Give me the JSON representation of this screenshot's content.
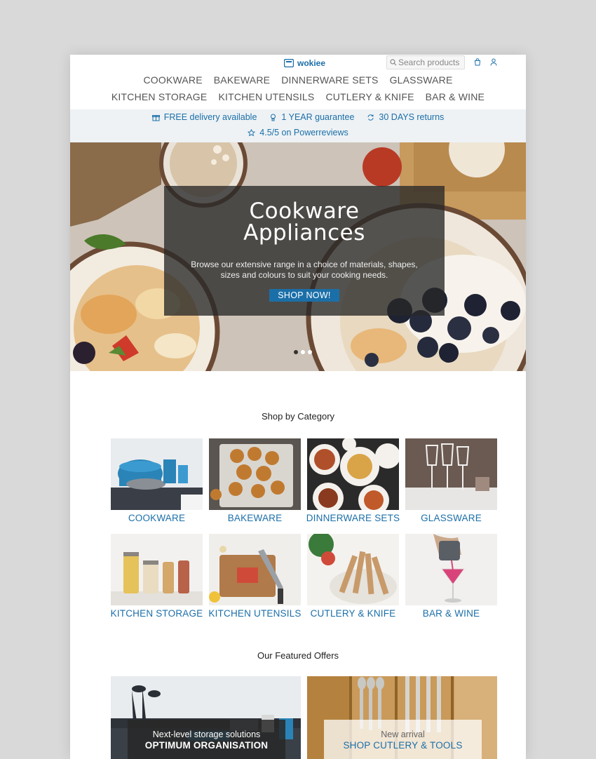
{
  "header": {
    "logo_text": "wokiee",
    "search_placeholder": "Search products",
    "icons": [
      "logo-icon",
      "search-icon",
      "cart-icon",
      "user-icon"
    ]
  },
  "nav": {
    "row1": [
      "COOKWARE",
      "BAKEWARE",
      "DINNERWARE SETS",
      "GLASSWARE"
    ],
    "row2": [
      "KITCHEN STORAGE",
      "KITCHEN UTENSILS",
      "CUTLERY & KNIFE",
      "BAR & WINE"
    ]
  },
  "benefits": {
    "delivery": "FREE delivery available",
    "guarantee": "1 YEAR guarantee",
    "returns": "30 DAYS returns",
    "reviews": "4.5/5 on Powerreviews"
  },
  "hero": {
    "title_line1": "Cookware",
    "title_line2": "Appliances",
    "subtitle": "Browse our extensive range in a choice of materials, shapes, sizes and colours to suit your cooking needs.",
    "button": "SHOP NOW!",
    "slides": 3,
    "active_slide": 1
  },
  "categories": {
    "title": "Shop by Category",
    "items": [
      "COOKWARE",
      "BAKEWARE",
      "DINNERWARE SETS",
      "GLASSWARE",
      "KITCHEN STORAGE",
      "KITCHEN UTENSILS",
      "CUTLERY & KNIFE",
      "BAR & WINE"
    ]
  },
  "offers": {
    "title": "Our Featured Offers",
    "items": [
      {
        "subtitle": "Next-level storage solutions",
        "title": "OPTIMUM ORGANISATION"
      },
      {
        "subtitle": "New arrival",
        "title": "SHOP CUTLERY & TOOLS"
      }
    ]
  },
  "colors": {
    "accent": "#1b6fa8",
    "benefit_bar": "#eef2f5",
    "overlay": "#282828"
  }
}
